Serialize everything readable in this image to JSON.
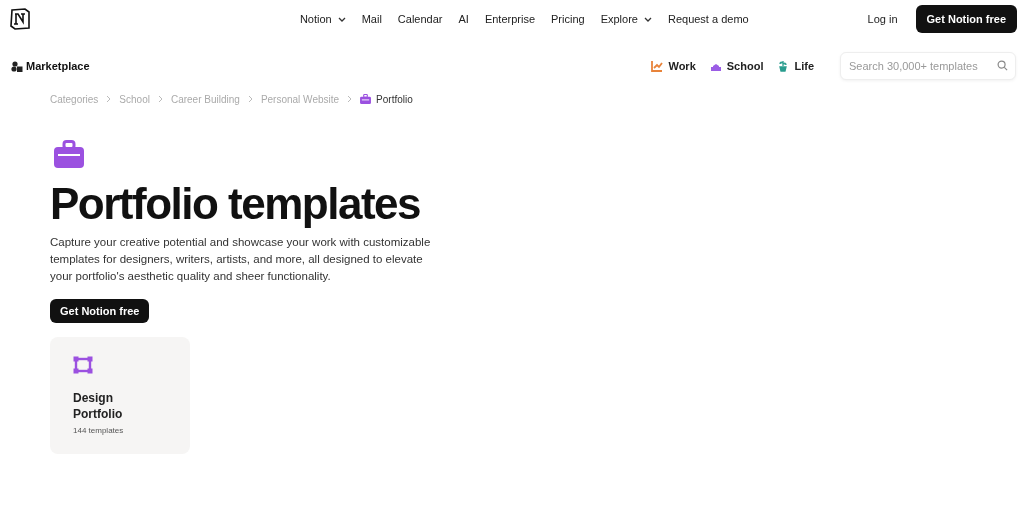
{
  "top_nav": {
    "items": [
      {
        "label": "Notion",
        "dropdown": true
      },
      {
        "label": "Mail",
        "dropdown": false
      },
      {
        "label": "Calendar",
        "dropdown": false
      },
      {
        "label": "AI",
        "dropdown": false
      },
      {
        "label": "Enterprise",
        "dropdown": false
      },
      {
        "label": "Pricing",
        "dropdown": false
      },
      {
        "label": "Explore",
        "dropdown": true
      },
      {
        "label": "Request a demo",
        "dropdown": false
      }
    ],
    "login": "Log in",
    "cta": "Get Notion free"
  },
  "marketplace": {
    "title": "Marketplace",
    "categories": [
      {
        "label": "Work",
        "kind": "chart",
        "color": "#e8833a"
      },
      {
        "label": "School",
        "kind": "building",
        "color": "#9b5de5"
      },
      {
        "label": "Life",
        "kind": "plant",
        "color": "#2a9d8f"
      }
    ],
    "search": {
      "placeholder": "Search 30,000+ templates"
    }
  },
  "breadcrumbs": [
    {
      "label": "Categories",
      "current": false
    },
    {
      "label": "School",
      "current": false
    },
    {
      "label": "Career Building",
      "current": false
    },
    {
      "label": "Personal Website",
      "current": false
    },
    {
      "label": "Portfolio",
      "current": true
    }
  ],
  "hero": {
    "title": "Portfolio templates",
    "description": "Capture your creative potential and showcase your work with customizable templates for designers, writers, artists, and more, all designed to elevate your portfolio's aesthetic quality and sheer functionality.",
    "button": "Get Notion free"
  },
  "cards": [
    {
      "title": "Design Portfolio",
      "count": "144 templates"
    }
  ]
}
